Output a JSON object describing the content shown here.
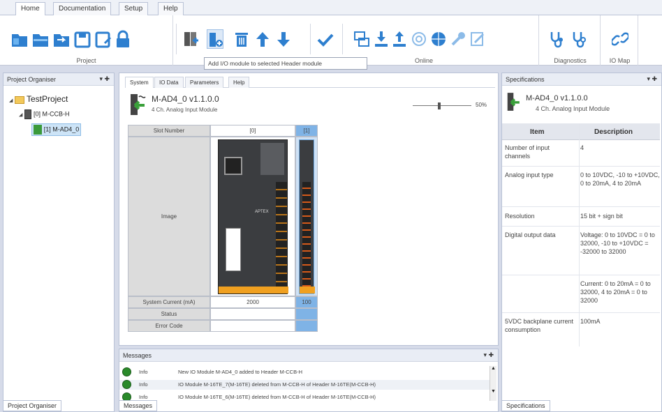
{
  "menu": {
    "tabs": [
      "Home",
      "Documentation",
      "Setup",
      "Help"
    ]
  },
  "ribbon": {
    "groups": {
      "project": "Project",
      "online": "Online",
      "diagnostics": "Diagnostics",
      "io_map": "IO Map"
    },
    "tooltip": "Add I/O module to selected Header module"
  },
  "organiser": {
    "title": "Project Organiser",
    "pin": "▾ ✚",
    "tree": {
      "project": "TestProject",
      "header": "[0] M-CCB-H",
      "module": "[1] M-AD4_0"
    },
    "bottom_tab": "Project Organiser"
  },
  "system": {
    "tabs": [
      "System",
      "IO Data",
      "Parameters",
      "Help"
    ],
    "module_name": "M-AD4_0 v1.1.0.0",
    "module_desc": "4 Ch. Analog Input Module",
    "zoom": "50%",
    "zoom_fraction": 0.45,
    "table": {
      "slot_number_label": "Slot Number",
      "slot0": "[0]",
      "slot1": "[1]",
      "image_label": "Image",
      "current_label": "System Current (mA)",
      "current0": "2000",
      "current1": "100",
      "status_label": "Status",
      "error_label": "Error Code",
      "device_brand": "APTEX"
    }
  },
  "messages": {
    "title": "Messages",
    "pin": "▾ ✚",
    "rows": [
      {
        "level": "Info",
        "text": "New IO Module M-AD4_0 added to Header M-CCB-H"
      },
      {
        "level": "Info",
        "text": "IO Module M-16TE_7(M-16TE) deleted from M-CCB-H of Header M-16TE(M-CCB-H)"
      },
      {
        "level": "Info",
        "text": "IO Module M-16TE_6(M-16TE) deleted from M-CCB-H of Header M-16TE(M-CCB-H)"
      }
    ],
    "bottom_tab": "Messages"
  },
  "specifications": {
    "title": "Specifications",
    "pin": "▾ ✚",
    "module_name": "M-AD4_0 v1.1.0.0",
    "module_desc": "4 Ch. Analog Input Module",
    "col_item": "Item",
    "col_desc": "Description",
    "rows": [
      {
        "item": "Number of input channels",
        "desc": "4"
      },
      {
        "item": "Analog input type",
        "desc": "0 to 10VDC, -10 to +10VDC, 0 to 20mA, 4 to 20mA"
      },
      {
        "item": "Resolution",
        "desc": "15 bit + sign bit"
      },
      {
        "item": "Digital output data",
        "desc": "Voltage: 0 to 10VDC = 0 to 32000, -10 to +10VDC = -32000 to 32000"
      },
      {
        "item": "",
        "desc": "Current: 0 to 20mA = 0 to 32000, 4 to 20mA = 0 to 32000"
      },
      {
        "item": "5VDC backplane current consumption",
        "desc": "100mA"
      }
    ],
    "bottom_tab": "Specifications"
  }
}
